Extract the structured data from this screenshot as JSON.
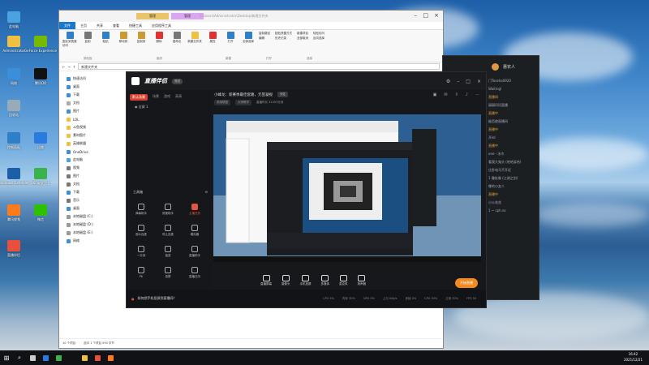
{
  "desktop": {
    "icons": [
      {
        "label": "此电脑",
        "color": "#4aa3df"
      },
      {
        "label": "Administrator",
        "color": "#f0c040"
      },
      {
        "label": "网络",
        "color": "#3a8fd8"
      },
      {
        "label": "回收站",
        "color": "#9ab"
      },
      {
        "label": "控制面板",
        "color": "#2f7fc8"
      },
      {
        "label": "Windows Defender",
        "color": "#1a5fa8"
      },
      {
        "label": "腾讯QQ",
        "color": "#111"
      },
      {
        "label": "GeForce Experience",
        "color": "#76b900"
      },
      {
        "label": "腾讯视频",
        "color": "#ff7a1a"
      },
      {
        "label": "迅雷",
        "color": "#2a7be0"
      },
      {
        "label": "微信",
        "color": "#2dc100"
      },
      {
        "label": "360安全卫士",
        "color": "#3cb34a"
      },
      {
        "label": "直播伴侣",
        "color": "#e84f3c"
      }
    ]
  },
  "explorer": {
    "title": "C:\\Users\\Administrator\\Desktop\\新建文件夹",
    "ctx_tab1": "管理",
    "ctx_tab2": "管理",
    "tabs": [
      "文件",
      "主页",
      "共享",
      "查看",
      "快捷工具",
      "应用程序工具"
    ],
    "ribbon": {
      "buttons": [
        "固定到快速访问",
        "复制",
        "粘贴",
        "移动到",
        "复制到",
        "删除",
        "重命名",
        "新建文件夹",
        "属性",
        "打开",
        "全部选择"
      ],
      "small": [
        "复制路径",
        "粘贴快捷方式",
        "新建项目",
        "轻松访问",
        "编辑",
        "历史记录",
        "全部取消",
        "反向选择"
      ],
      "groups": [
        "剪贴板",
        "组织",
        "新建",
        "打开",
        "选择"
      ]
    },
    "address": "新建文件夹",
    "nav": [
      {
        "label": "快速访问",
        "color": "#3a8fd8"
      },
      {
        "label": "桌面",
        "color": "#3a8fd8"
      },
      {
        "label": "下载",
        "color": "#3a8fd8"
      },
      {
        "label": "文档",
        "color": "#aaa"
      },
      {
        "label": "图片",
        "color": "#3a8fd8"
      },
      {
        "label": "LOL",
        "color": "#f0c040"
      },
      {
        "label": "斗鱼视频",
        "color": "#f0c040"
      },
      {
        "label": "素材图片",
        "color": "#f0c040"
      },
      {
        "label": "英雄联盟",
        "color": "#f0c040"
      },
      {
        "label": "OneDrive",
        "color": "#3a8fd8"
      },
      {
        "label": "此电脑",
        "color": "#4aa3df"
      },
      {
        "label": "视频",
        "color": "#777"
      },
      {
        "label": "图片",
        "color": "#777"
      },
      {
        "label": "文档",
        "color": "#777"
      },
      {
        "label": "下载",
        "color": "#3a8fd8"
      },
      {
        "label": "音乐",
        "color": "#777"
      },
      {
        "label": "桌面",
        "color": "#3a8fd8"
      },
      {
        "label": "本地磁盘 (C:)",
        "color": "#999"
      },
      {
        "label": "本地磁盘 (D:)",
        "color": "#999"
      },
      {
        "label": "本地磁盘 (E:)",
        "color": "#999"
      },
      {
        "label": "网络",
        "color": "#3a8fd8"
      }
    ],
    "status_count": "10 个项目",
    "status_selected": "选中 1 个项目  590 字节"
  },
  "chat": {
    "username": "惠农人",
    "lines": [
      {
        "text": "门Toosha0920",
        "hl": false
      },
      {
        "text": "Waiting!",
        "hl": false
      },
      {
        "text": "直播间",
        "hl": true
      },
      {
        "text": "弱弱问问直播",
        "hl": false
      },
      {
        "text": "直播中",
        "hl": true
      },
      {
        "text": "能否使直播间",
        "hl": false
      },
      {
        "text": "直播中",
        "hl": true
      },
      {
        "text": "开lol",
        "hl": false
      },
      {
        "text": "直播中",
        "hl": true
      },
      {
        "text": "one - 冰冷",
        "hl": false
      },
      {
        "text": "看我大鬼头 (哈哈笑哈)",
        "hl": false
      },
      {
        "text": "仕卧电马不开近",
        "hl": false
      },
      {
        "text": "1 撤处像 (江湖之剑)",
        "hl": false
      },
      {
        "text": "哪的小女人",
        "hl": false
      },
      {
        "text": "直播中",
        "hl": true
      },
      {
        "text": "小火花花",
        "hl": false
      },
      {
        "text": "1 ~ cph.sx",
        "hl": false
      }
    ]
  },
  "app": {
    "logo": "直播伴侣",
    "version": "测试",
    "left_tabs": [
      "默认场景",
      "场景",
      "游戏",
      "高清"
    ],
    "scene_label": "全屏 1",
    "tools_header": "工具箱",
    "tools": [
      "弹幕助手",
      "房管助手",
      "主播任务",
      "观众连麦",
      "停止连麦",
      "模拟器",
      "一分钟",
      "抽奖",
      "直播助手",
      "PK",
      "录屏",
      "直播日历"
    ],
    "title": "小峰龙：新赛季最佳套路，元芸凝视",
    "title_tag": "分区",
    "sub_tags": [
      "英雄联盟",
      "大师教学"
    ],
    "sub_meta": "直播时长 31453分钟",
    "bottom_buttons": [
      "直播屏幕",
      "摄像头",
      "手机投屏",
      "多媒体",
      "麦克风",
      "扬声器"
    ],
    "live_button": "开始直播",
    "footer_tip": "如何把手机投屏到直播间？",
    "stats": [
      "CPU 5%",
      "内存 30%",
      "GPU 5%",
      "上行 0kb/s",
      "丢帧 0%",
      "CPU 30%",
      "占用 30%",
      "FPS 30"
    ]
  },
  "taskbar": {
    "apps": [
      {
        "name": "task-view",
        "color": "#ccc"
      },
      {
        "name": "edge",
        "color": "#2a7be0"
      },
      {
        "name": "360",
        "color": "#3cb34a"
      },
      {
        "name": "douyin",
        "color": "#111"
      },
      {
        "name": "explorer",
        "color": "#f0c040"
      },
      {
        "name": "live-companion",
        "color": "#e84f3c"
      },
      {
        "name": "app",
        "color": "#ff7a1a"
      }
    ],
    "time": "16:42",
    "date": "2021/12/21"
  }
}
